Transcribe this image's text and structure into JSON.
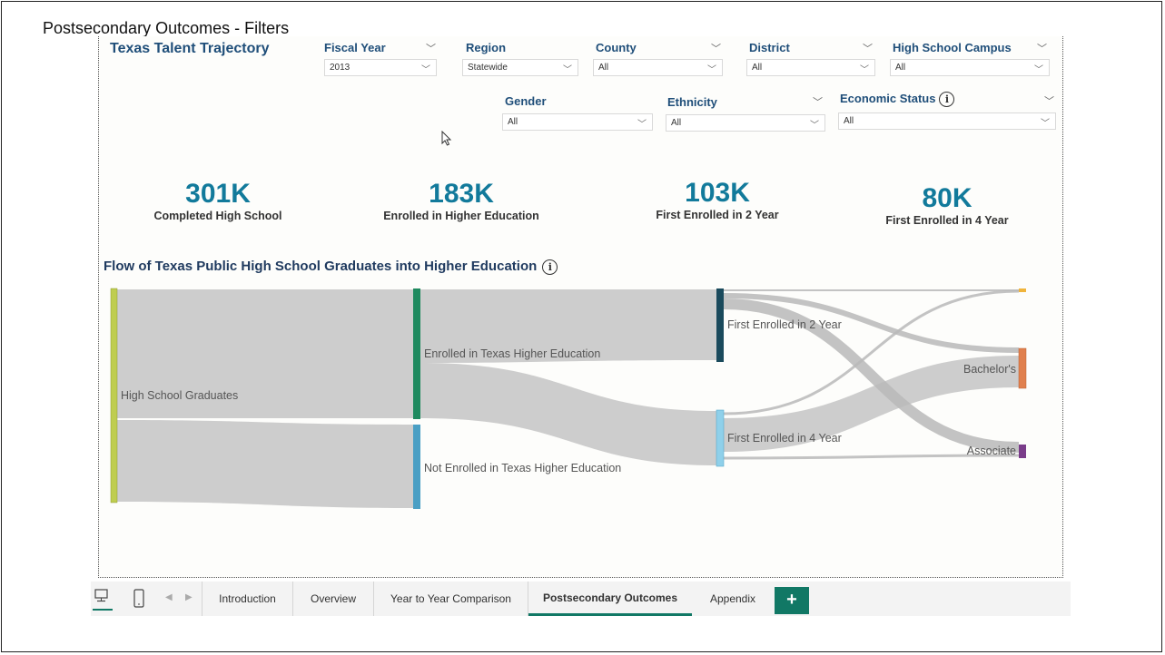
{
  "slide_title": "Postsecondary Outcomes - Filters",
  "report": {
    "brand": "Texas Talent Trajectory",
    "filters": {
      "fiscal_year": {
        "label": "Fiscal Year",
        "value": "2013"
      },
      "region": {
        "label": "Region",
        "value": "Statewide"
      },
      "county": {
        "label": "County",
        "value": "All"
      },
      "district": {
        "label": "District",
        "value": "All"
      },
      "campus": {
        "label": "High School Campus",
        "value": "All"
      },
      "gender": {
        "label": "Gender",
        "value": "All"
      },
      "ethnicity": {
        "label": "Ethnicity",
        "value": "All"
      },
      "economic_status": {
        "label": "Economic Status",
        "value": "All"
      }
    },
    "kpis": [
      {
        "value": "301K",
        "caption": "Completed High School"
      },
      {
        "value": "183K",
        "caption": "Enrolled in Higher Education"
      },
      {
        "value": "103K",
        "caption": "First Enrolled in 2 Year"
      },
      {
        "value": "80K",
        "caption": "First Enrolled in 4 Year"
      }
    ],
    "chart_title": "Flow of Texas Public High School Graduates into Higher Education",
    "chart_data": {
      "type": "sankey",
      "nodes": [
        {
          "name": "High School Graduates",
          "color": "#bfcd4f"
        },
        {
          "name": "Enrolled in Texas Higher Education",
          "color": "#1f8a5f"
        },
        {
          "name": "Not Enrolled in Texas Higher Education",
          "color": "#4a9fc4"
        },
        {
          "name": "First Enrolled in 2 Year",
          "color": "#1a4a5c"
        },
        {
          "name": "First Enrolled in 4 Year",
          "color": "#8fd0ea"
        },
        {
          "name": "",
          "color": "#f0b43c"
        },
        {
          "name": "Bachelor's",
          "color": "#e0804e"
        },
        {
          "name": "Associate",
          "color": "#7a3d8a"
        }
      ]
    }
  },
  "tabs": {
    "introduction": "Introduction",
    "overview": "Overview",
    "year_to_year": "Year to Year Comparison",
    "postsecondary": "Postsecondary Outcomes",
    "appendix": "Appendix",
    "add": "+"
  },
  "icons": {
    "info": "info-icon",
    "desktop": "desktop-view-icon",
    "mobile": "mobile-view-icon",
    "prev": "chevron-left-icon",
    "next": "chevron-right-icon"
  }
}
